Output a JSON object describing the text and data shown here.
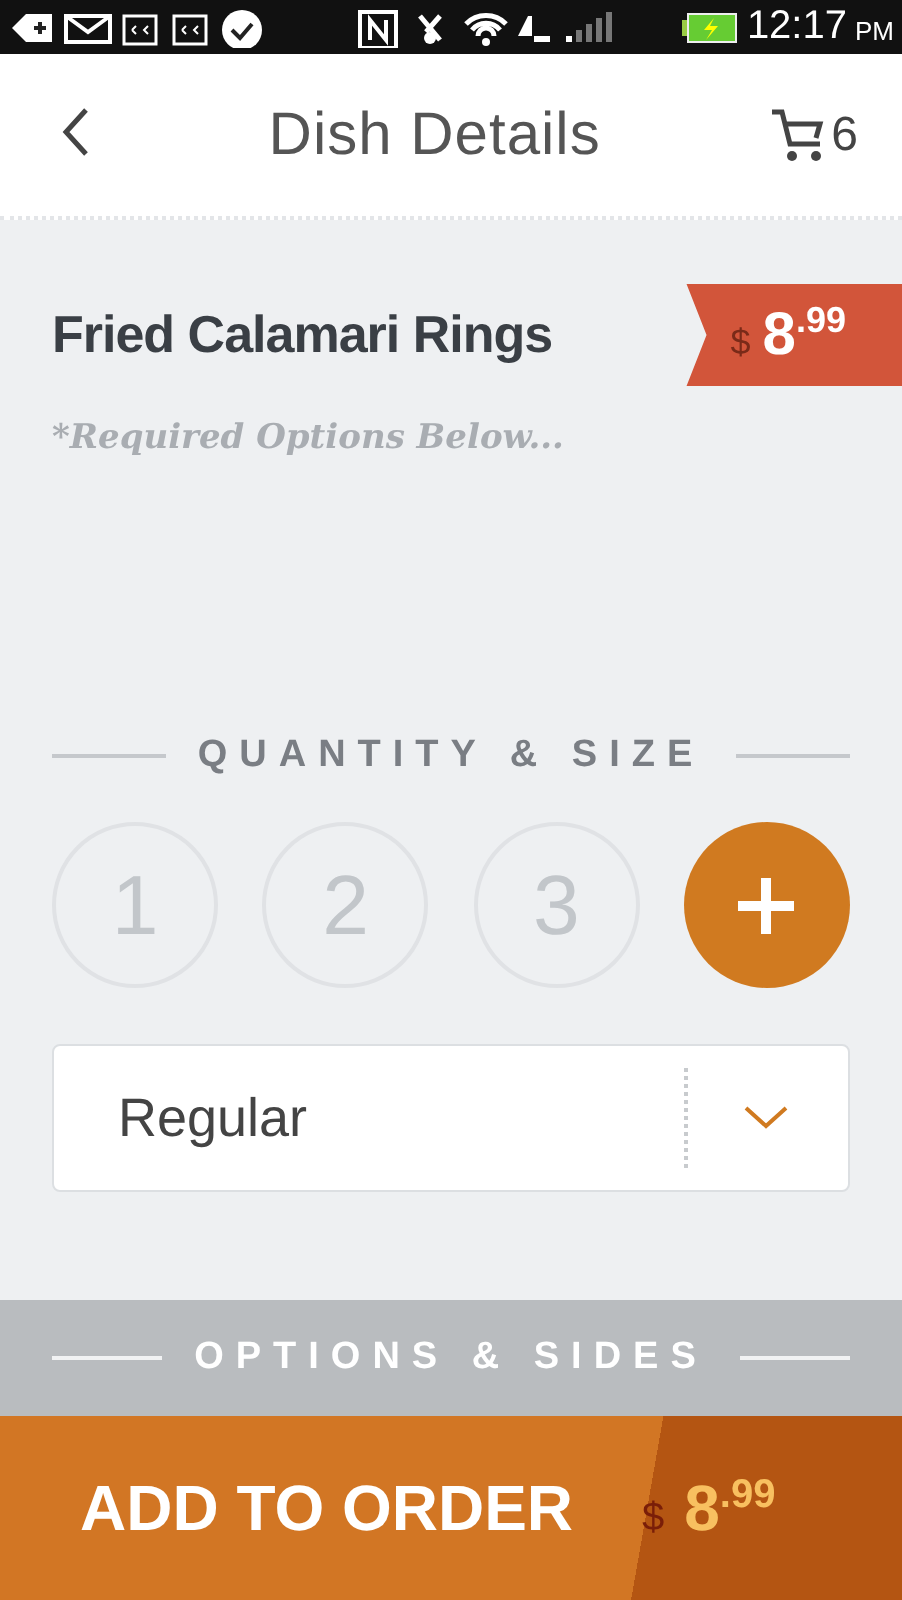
{
  "status_bar": {
    "time": "12:17",
    "period": "PM",
    "battery": {
      "charging": true
    }
  },
  "header": {
    "title": "Dish Details",
    "cart_count": "6"
  },
  "dish": {
    "name": "Fried Calamari Rings",
    "currency": "$",
    "price": "8$^{.99}$",
    "note": "*Required Options Below..."
  },
  "quantity_section": {
    "heading": "QUANTITY & SIZE",
    "quantities": [
      {
        "label": "1",
        "selected": false
      },
      {
        "label": "2",
        "selected": false
      },
      {
        "label": "3",
        "selected": false
      }
    ],
    "size": {
      "value": "Regular"
    }
  },
  "options_section": {
    "heading": "OPTIONS & SIDES"
  },
  "order_bar": {
    "label": "ADD TO ORDER",
    "currency": "$",
    "price": "8$^{.99}$"
  }
}
